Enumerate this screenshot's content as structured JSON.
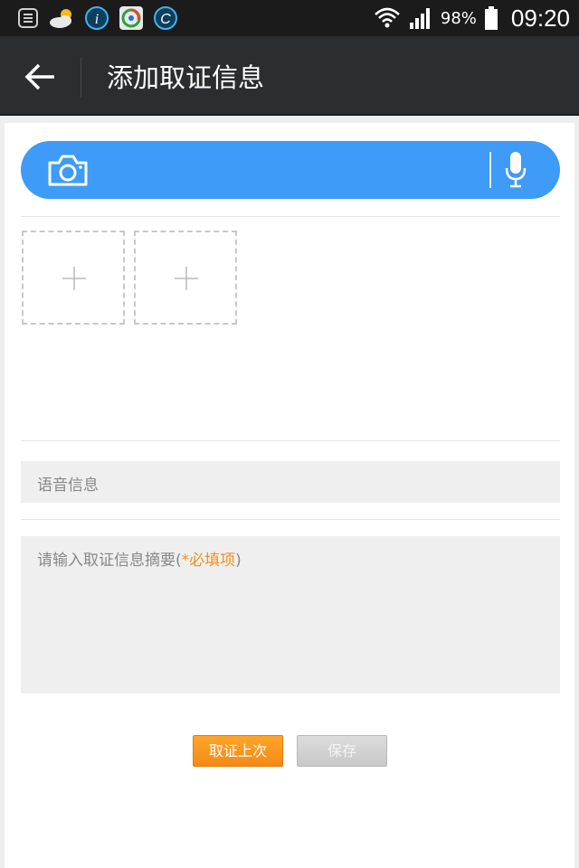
{
  "status_bar": {
    "icons": [
      "notification-list-icon",
      "weather-icon",
      "info-app-icon",
      "browser-app-icon",
      "c-app-icon"
    ],
    "battery_percent": "98%",
    "time": "09:20"
  },
  "header": {
    "back_icon": "back-arrow-icon",
    "title": "添加取证信息"
  },
  "capture_bar": {
    "camera_icon": "camera-icon",
    "mic_icon": "microphone-icon",
    "color": "#3e9bf7"
  },
  "photos": {
    "add_icon": "plus-icon",
    "slot_count": 2
  },
  "voice_info": {
    "label": "语音信息"
  },
  "summary": {
    "placeholder": "请输入取证信息摘要",
    "paren_open": "(",
    "required_label": "*必填项",
    "paren_close": ")",
    "required_color": "#f28f1c"
  },
  "buttons": {
    "primary_label": "取证上次",
    "save_label": "保存"
  }
}
